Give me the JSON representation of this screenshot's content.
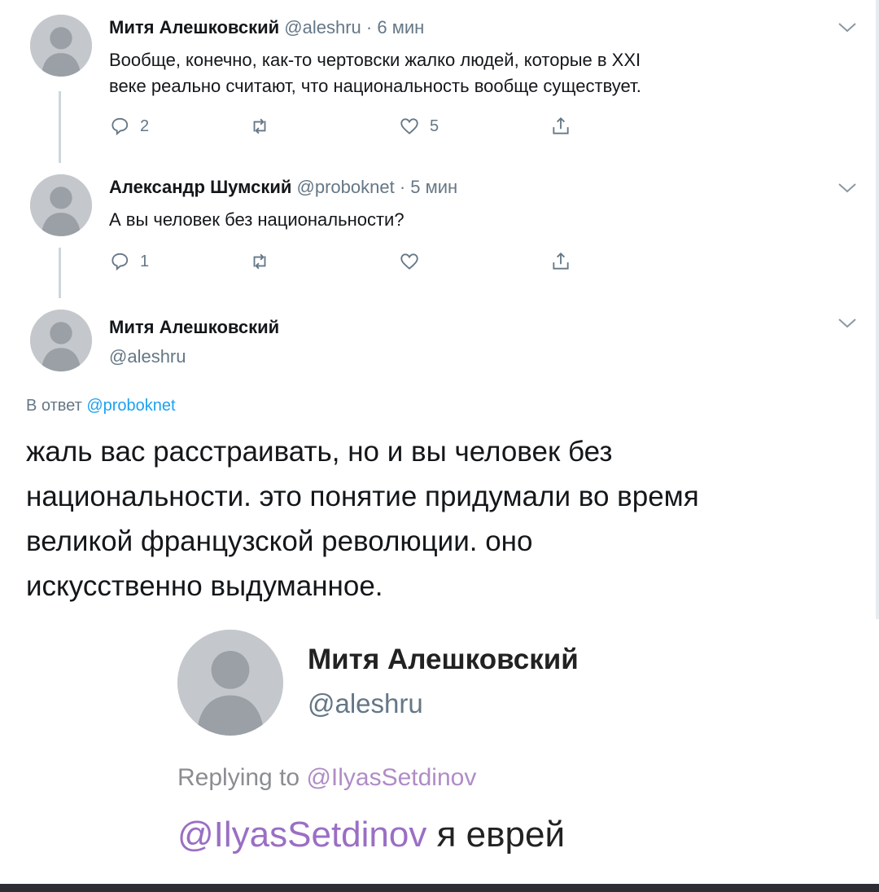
{
  "tweets": [
    {
      "name": "Митя Алешковский",
      "handle": "@aleshru",
      "sep": "·",
      "time": "6 мин",
      "text_line1": "Вообще, конечно, как-то чертовски жалко людей, которые в XXI",
      "text_line2": "веке реально считают, что национальность вообще существует.",
      "replies": "2",
      "likes": "5"
    },
    {
      "name": "Александр Шумский",
      "handle": "@proboknet",
      "sep": "·",
      "time": "5 мин",
      "text": "А вы человек без национальности?",
      "replies": "1"
    }
  ],
  "main_tweet": {
    "name": "Митя Алешковский",
    "handle": "@aleshru",
    "reply_prefix": "В ответ",
    "reply_mention": "@proboknet",
    "text_lines": [
      "жаль вас расстраивать, но и вы человек без",
      "национальности. это понятие придумали во время",
      "великой французской революции. оно",
      "искусственно выдуманное."
    ]
  },
  "quoted": {
    "name": "Митя Алешковский",
    "handle": "@aleshru",
    "replying_prefix": "Replying to",
    "replying_mention": "@IlyasSetdinov",
    "text_mention": "@IlyasSetdinov",
    "text": "я еврей"
  },
  "colors": {
    "link": "#1da1f2",
    "muted": "#657786",
    "thread_line": "#ccd6dd"
  },
  "icons": {
    "reply": "reply-icon",
    "retweet": "retweet-icon",
    "like": "heart-icon",
    "share": "share-icon",
    "more": "chevron-down-icon",
    "avatar": "placeholder-avatar"
  }
}
